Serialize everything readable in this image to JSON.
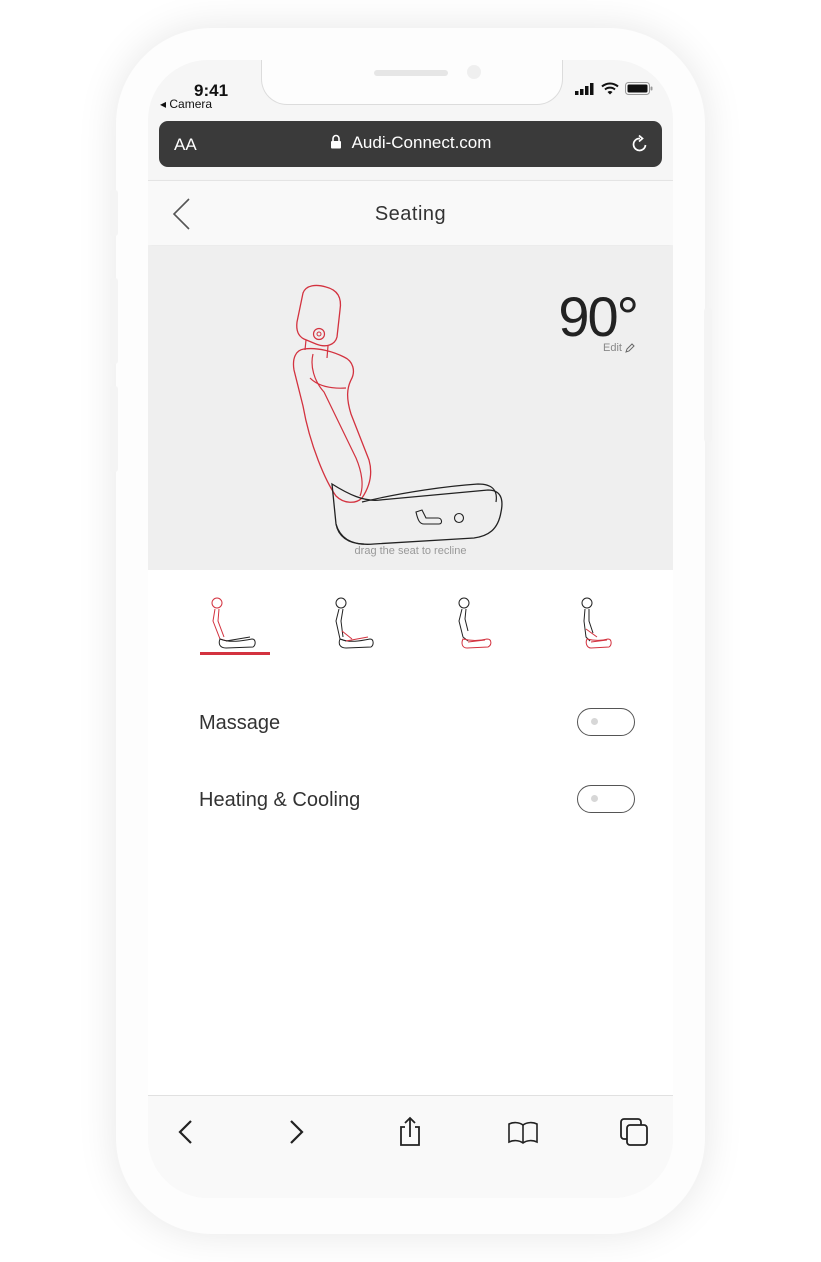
{
  "status": {
    "time": "9:41",
    "back_app": "◂ Camera"
  },
  "browser": {
    "text_size": "AA",
    "url": "Audi-Connect.com"
  },
  "header": {
    "title": "Seating"
  },
  "seat": {
    "angle": "90°",
    "edit_label": "Edit",
    "hint": "drag the seat to recline"
  },
  "presets": {
    "selected_index": 0,
    "count": 4
  },
  "options": [
    {
      "label": "Massage",
      "on": false
    },
    {
      "label": "Heating & Cooling",
      "on": false
    }
  ],
  "colors": {
    "accent": "#d3323f",
    "dark": "#222222",
    "url_bar": "#3a3a3a"
  },
  "icons": {
    "back": "chevron-left-icon",
    "nav": [
      "chevron-left-icon",
      "chevron-right-icon",
      "share-icon",
      "bookmarks-icon",
      "tabs-icon"
    ]
  }
}
